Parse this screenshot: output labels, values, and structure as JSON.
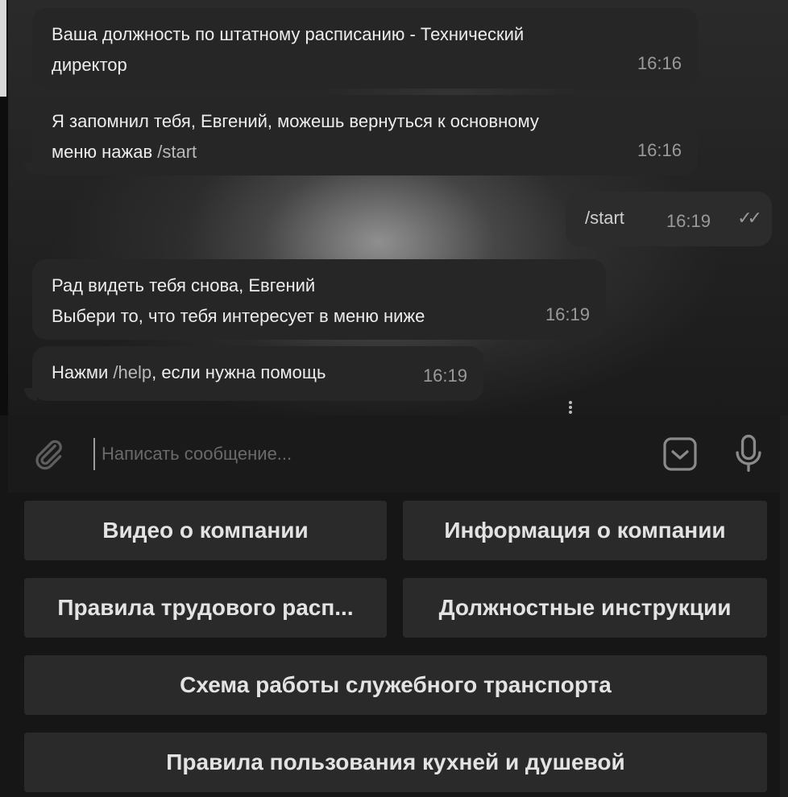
{
  "messages": [
    {
      "text_line1": "Ваша должность по штатному расписанию - Технический",
      "text_line2": "директор",
      "time": "16:16"
    },
    {
      "text_line1": "Я запомнил тебя, Евгений, можешь вернуться к основному",
      "text_line2_prefix": "меню нажав ",
      "text_line2_cmd": "/start",
      "time": "16:16"
    },
    {
      "text": "/start",
      "time": "16:19",
      "status": "read"
    },
    {
      "text_line1": "Рад видеть тебя снова, Евгений",
      "text_line2": "Выбери то, что тебя интересует в меню ниже",
      "time": "16:19"
    },
    {
      "prefix": "Нажми ",
      "cmd": "/help",
      "suffix": ", если нужна помощь",
      "time": "16:19"
    }
  ],
  "composer": {
    "placeholder": "Написать сообщение...",
    "attach_icon": "paperclip-icon",
    "keyboard_icon": "keyboard-toggle-icon",
    "mic_icon": "microphone-icon"
  },
  "keyboard": {
    "buttons": [
      "Видео о компании",
      "Информация о компании",
      "Правила трудового расп...",
      "Должностные инструкции",
      "Схема работы служебного транспорта",
      "Правила пользования кухней и душевой"
    ]
  },
  "colors": {
    "bubble_in": "#262626",
    "bubble_out": "#2c2c2c",
    "button_bg": "#2a2a2a",
    "text": "#ededed",
    "muted": "#9a9a9a"
  }
}
